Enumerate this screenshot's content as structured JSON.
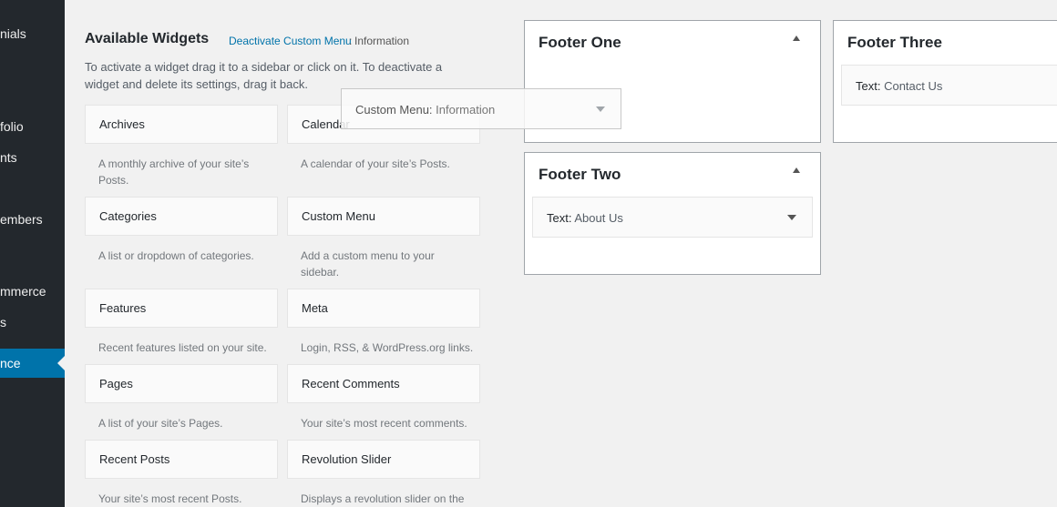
{
  "sidebar": {
    "items": [
      {
        "label": "nials"
      },
      {
        "label": "folio"
      },
      {
        "label": "nts"
      },
      {
        "label": "embers"
      },
      {
        "label": "mmerce"
      },
      {
        "label": "s"
      },
      {
        "label": "nce"
      }
    ]
  },
  "available": {
    "title": "Available Widgets",
    "deactivate_link": "Deactivate Custom Menu",
    "deactivate_info": "Information",
    "description": "To activate a widget drag it to a sidebar or click on it. To deactivate a widget and delete its settings, drag it back."
  },
  "widgets": [
    {
      "title": "Archives",
      "desc": "A monthly archive of your site’s Posts."
    },
    {
      "title": "Calendar",
      "desc": "A calendar of your site’s Posts."
    },
    {
      "title": "Categories",
      "desc": "A list or dropdown of categories."
    },
    {
      "title": "Custom Menu",
      "desc": "Add a custom menu to your sidebar."
    },
    {
      "title": "Features",
      "desc": "Recent features listed on your site."
    },
    {
      "title": "Meta",
      "desc": "Login, RSS, & WordPress.org links."
    },
    {
      "title": "Pages",
      "desc": "A list of your site’s Pages."
    },
    {
      "title": "Recent Comments",
      "desc": "Your site’s most recent comments."
    },
    {
      "title": "Recent Posts",
      "desc": "Your site’s most recent Posts."
    },
    {
      "title": "Revolution Slider",
      "desc": "Displays a revolution slider on the"
    }
  ],
  "dragging": {
    "type": "Custom Menu",
    "name": "Information"
  },
  "footers": {
    "one": {
      "title": "Footer One"
    },
    "two": {
      "title": "Footer Two",
      "widget_type": "Text",
      "widget_name": "About Us"
    },
    "three": {
      "title": "Footer Three",
      "widget_type": "Text",
      "widget_name": "Contact Us"
    }
  },
  "colors": {
    "accent": "#0073aa",
    "sidebar_bg": "#23282d",
    "page_bg": "#f1f1f1"
  }
}
